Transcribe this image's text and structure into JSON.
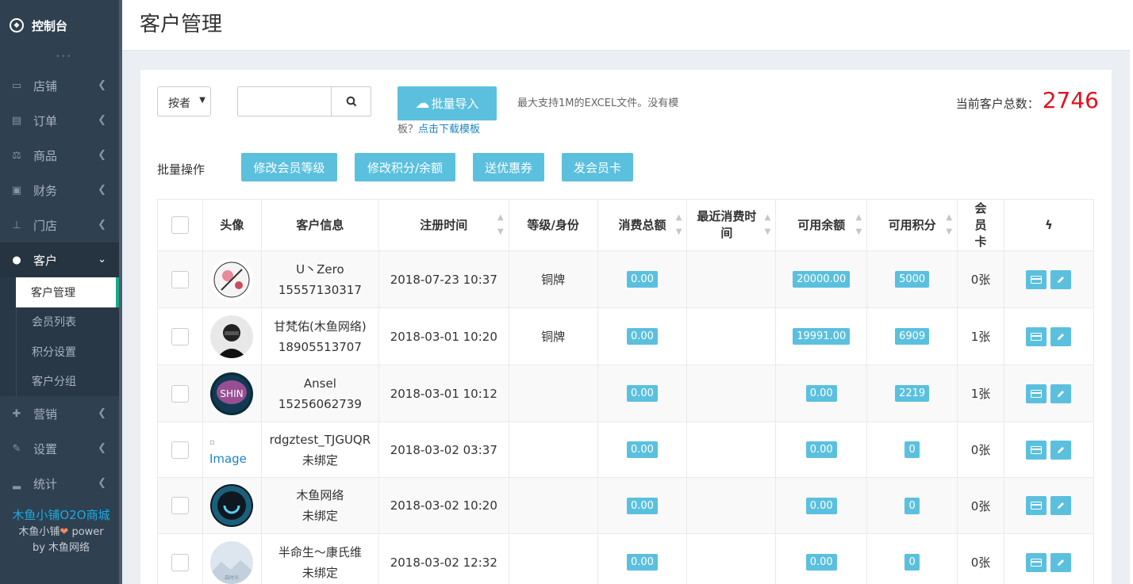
{
  "sidebar": {
    "brand": "控制台",
    "items": [
      {
        "label": "店铺",
        "icon": "basket-icon"
      },
      {
        "label": "订单",
        "icon": "ticket-icon"
      },
      {
        "label": "商品",
        "icon": "balance-scale-icon"
      },
      {
        "label": "财务",
        "icon": "money-icon"
      },
      {
        "label": "门店",
        "icon": "sitemap-icon"
      },
      {
        "label": "客户",
        "icon": "users-icon"
      },
      {
        "label": "营销",
        "icon": "gift-icon"
      },
      {
        "label": "设置",
        "icon": "wrench-icon"
      },
      {
        "label": "统计",
        "icon": "signal-icon"
      }
    ],
    "submenu": [
      "客户管理",
      "会员列表",
      "积分设置",
      "客户分组"
    ],
    "footer_line1": "木鱼小铺O2O商城",
    "footer_line2": "木鱼小铺",
    "footer_power": "power",
    "footer_line3": "by 木鱼网络"
  },
  "header": {
    "title": "客户管理"
  },
  "toolbar": {
    "select_value": "按者",
    "import_label": "批量导入",
    "hint1": "最大支持1M的EXCEL文件。没有模",
    "hint2_prefix": "板？",
    "hint2_link": "点击下载模板",
    "total_label": "当前客户总数：",
    "total_value": "2746"
  },
  "bulk": {
    "label": "批量操作",
    "buttons": [
      "修改会员等级",
      "修改积分/余额",
      "送优惠券",
      "发会员卡"
    ]
  },
  "table": {
    "headers": [
      "头像",
      "客户信息",
      "注册时间",
      "等级/身份",
      "消费总额",
      "最近消费时间",
      "可用余额",
      "可用积分",
      "会员卡"
    ],
    "rows": [
      {
        "name": "U丶Zero",
        "phone": "15557130317",
        "reg": "2018-07-23 10:37",
        "level": "铜牌",
        "spent": "0.00",
        "last": "",
        "balance": "20000.00",
        "points": "5000",
        "cards": "0张"
      },
      {
        "name": "甘梵佑(木鱼网络)",
        "phone": "18905513707",
        "reg": "2018-03-01 10:20",
        "level": "铜牌",
        "spent": "0.00",
        "last": "",
        "balance": "19991.00",
        "points": "6909",
        "cards": "1张"
      },
      {
        "name": "Ansel",
        "phone": "15256062739",
        "reg": "2018-03-01 10:12",
        "level": "",
        "spent": "0.00",
        "last": "",
        "balance": "0.00",
        "points": "2219",
        "cards": "1张"
      },
      {
        "name": "rdgztest_TJGUQR",
        "phone": "未绑定",
        "reg": "2018-03-02 03:37",
        "level": "",
        "spent": "0.00",
        "last": "",
        "balance": "0.00",
        "points": "0",
        "cards": "0张",
        "img_alt": "Image"
      },
      {
        "name": "木鱼网络",
        "phone": "未绑定",
        "reg": "2018-03-02 10:20",
        "level": "",
        "spent": "0.00",
        "last": "",
        "balance": "0.00",
        "points": "0",
        "cards": "0张"
      },
      {
        "name": "半命生～康氏维",
        "phone": "未绑定",
        "reg": "2018-03-02 12:32",
        "level": "",
        "spent": "0.00",
        "last": "",
        "balance": "0.00",
        "points": "0",
        "cards": "0张"
      }
    ]
  },
  "colors": {
    "sidebar": "#2f4050",
    "accent": "#5bc0de",
    "total": "#e3101a",
    "link": "#1c84c6"
  }
}
